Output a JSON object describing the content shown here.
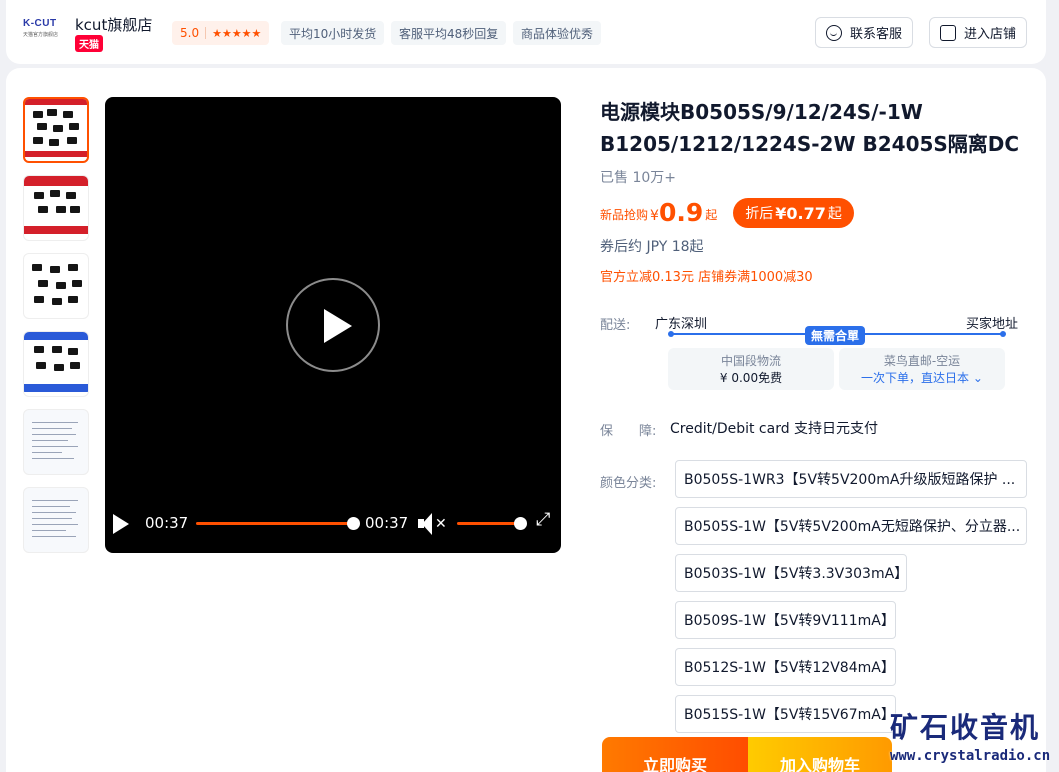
{
  "shop": {
    "logo_text": "K-CUT",
    "logo_sub": "天猫官方旗舰店",
    "name": "kcut旗舰店",
    "badge": "天猫",
    "score": "5.0",
    "stars": "★★★★★",
    "tags": [
      "平均10小时发货",
      "客服平均48秒回复",
      "商品体验优秀"
    ],
    "contact_label": "联系客服",
    "enter_label": "进入店铺"
  },
  "video": {
    "current_time": "00:37",
    "duration": "00:37",
    "progress": 1.0,
    "volume": 1.0,
    "muted": true
  },
  "product": {
    "title": "电源模块B0505S/9/12/24S/-1W B1205/1212/1224S-2W B2405S隔离DC",
    "sold": "已售 10万+",
    "price_label": "新品抢购",
    "currency": "¥",
    "price": "0.9",
    "price_suffix": "起",
    "after_label": "折后",
    "after_price": "¥0.77",
    "after_suffix": "起",
    "jpy": "券后约 JPY 18起",
    "promo": "官方立减0.13元 店铺券满1000减30"
  },
  "shipping": {
    "label": "配送:",
    "from": "广东深圳",
    "to": "买家地址",
    "free_tag": "無需合單",
    "options": [
      {
        "name": "中国段物流",
        "value": "¥ 0.00免费"
      },
      {
        "name": "菜鸟直邮-空运",
        "value": "一次下单，直达日本"
      }
    ]
  },
  "guarantee": {
    "label": "保　　障:",
    "value": "Credit/Debit card 支持日元支付"
  },
  "colors": {
    "label": "颜色分类:",
    "options": [
      "B0505S-1WR3【5V转5V200mA升级版短路保护 ...",
      "B0505S-1W【5V转5V200mA无短路保护、分立器...",
      "B0503S-1W【5V转3.3V303mA】",
      "B0509S-1W【5V转9V111mA】",
      "B0512S-1W【5V转12V84mA】",
      "B0515S-1W【5V转15V67mA】"
    ]
  },
  "actions": {
    "buy": "立即购买",
    "cart": "加入购物车"
  },
  "watermark": {
    "line1": "矿石收音机",
    "line2": "www.crystalradio.cn"
  },
  "theme": {
    "accent": "#ff5000",
    "blue": "#2b6fea"
  }
}
